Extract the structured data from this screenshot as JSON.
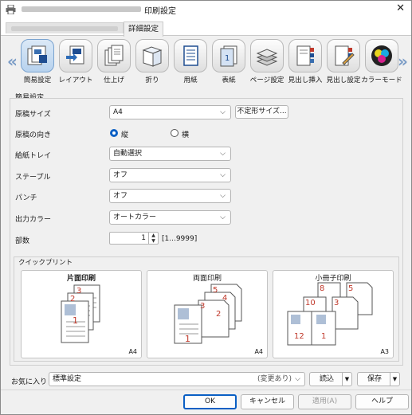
{
  "window": {
    "title": "印刷設定",
    "close_glyph": "✕",
    "active_tab": "詳細設定"
  },
  "toolbar": {
    "left_arrow": "«",
    "right_arrow": "»",
    "items": [
      {
        "label": "簡易設定",
        "icon": "quick-setup-icon",
        "selected": true
      },
      {
        "label": "レイアウト",
        "icon": "layout-icon"
      },
      {
        "label": "仕上げ",
        "icon": "finishing-icon"
      },
      {
        "label": "折り",
        "icon": "fold-icon"
      },
      {
        "label": "用紙",
        "icon": "paper-icon"
      },
      {
        "label": "表紙",
        "icon": "cover-icon"
      },
      {
        "label": "ページ設定",
        "icon": "page-setup-icon"
      },
      {
        "label": "見出し挿入",
        "icon": "tab-insert-icon"
      },
      {
        "label": "見出し設定",
        "icon": "tab-setting-icon"
      },
      {
        "label": "カラーモード",
        "icon": "color-mode-icon"
      }
    ]
  },
  "quick": {
    "section_title": "簡易設定",
    "original_size": {
      "label": "原稿サイズ",
      "value": "A4",
      "custom_button": "不定形サイズ..."
    },
    "orientation": {
      "label": "原稿の向き",
      "portrait": "縦",
      "landscape": "横",
      "selected": "portrait"
    },
    "paper_tray": {
      "label": "給紙トレイ",
      "value": "自動選択"
    },
    "staple": {
      "label": "ステープル",
      "value": "オフ"
    },
    "punch": {
      "label": "パンチ",
      "value": "オフ"
    },
    "output_color": {
      "label": "出力カラー",
      "value": "オートカラー"
    },
    "copies": {
      "label": "部数",
      "value": "1",
      "range": "[1...9999]"
    }
  },
  "quick_print": {
    "title": "クイックプリント",
    "cards": [
      {
        "title": "片面印刷",
        "size": "A4",
        "page_numbers": [
          "3",
          "2",
          "1"
        ]
      },
      {
        "title": "両面印刷",
        "size": "A4",
        "page_numbers": [
          "5",
          "4",
          "3",
          "2",
          "1"
        ]
      },
      {
        "title": "小冊子印刷",
        "size": "A3",
        "page_numbers": [
          "8",
          "5",
          "10",
          "3",
          "12",
          "1"
        ]
      }
    ]
  },
  "favorites": {
    "label": "お気に入り",
    "value": "標準設定",
    "hint": "(変更あり)",
    "load": "読込",
    "save": "保存"
  },
  "footer": {
    "ok": "OK",
    "cancel": "キャンセル",
    "apply": "適用(A)",
    "help": "ヘルプ"
  },
  "colors": {
    "accent": "#0a5fc4",
    "page_number": "#c0392b",
    "toolbar_arrow": "#7a9cc6"
  }
}
